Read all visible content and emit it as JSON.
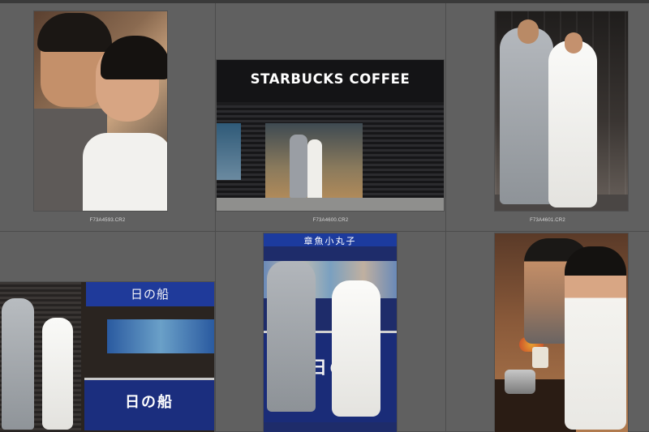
{
  "grid": {
    "cells": [
      {
        "filename": "F73A4593.CR2"
      },
      {
        "filename": "F73A4600.CR2",
        "sign_text": "STARBUCKS COFFEE"
      },
      {
        "filename": "F73A4601.CR2"
      },
      {
        "filename": "",
        "sign_top": "日の船",
        "sign_stall": "日の船"
      },
      {
        "filename": "",
        "sign_top": "章魚小丸子",
        "sign_stall": "日の船"
      },
      {
        "filename": ""
      }
    ]
  }
}
